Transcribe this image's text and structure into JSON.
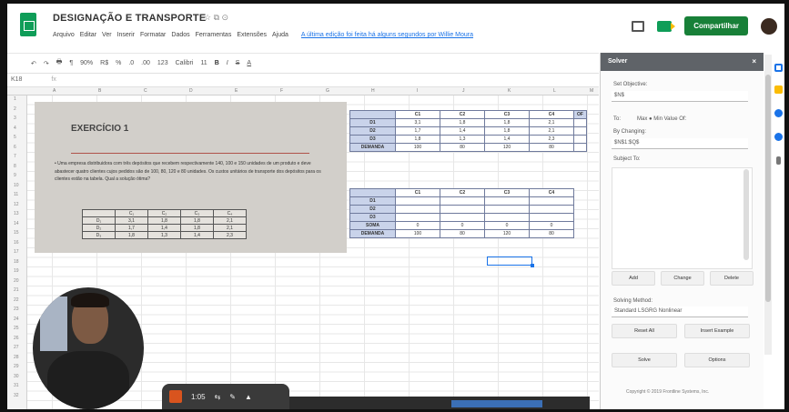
{
  "header": {
    "title": "DESIGNAÇÃO E TRANSPORTE",
    "title_icons": "☆ ⧉ ⊙",
    "menu": [
      "Arquivo",
      "Editar",
      "Ver",
      "Inserir",
      "Formatar",
      "Dados",
      "Ferramentas",
      "Extensões",
      "Ajuda"
    ],
    "last_edit": "A última edição foi feita há alguns segundos por Willie Moura",
    "share_label": "Compartilhar"
  },
  "toolbar": {
    "items": [
      "↶",
      "↷",
      "🖶",
      "¶",
      "90%",
      "R$",
      "%",
      ".0",
      ".00",
      "123",
      "Calibri",
      "11",
      "B",
      "I",
      "S",
      "A"
    ],
    "cell_ref": "K18",
    "fx": "fx"
  },
  "columns": [
    "A",
    "B",
    "C",
    "D",
    "E",
    "F",
    "G",
    "H",
    "I",
    "J",
    "K",
    "L",
    "M"
  ],
  "rows": [
    "1",
    "2",
    "3",
    "4",
    "5",
    "6",
    "7",
    "8",
    "9",
    "10",
    "11",
    "12",
    "13",
    "14",
    "15",
    "16",
    "17",
    "18",
    "19",
    "20",
    "21",
    "22",
    "23",
    "24",
    "25",
    "26",
    "27",
    "28",
    "29",
    "30",
    "31",
    "32"
  ],
  "exercise": {
    "title": "EXERCÍCIO 1",
    "text": "• Uma empresa distribuidora com três depósitos que recebem respectivamente 140, 100 e 150 unidades de um produto e deve abastecer quatro clientes cujos pedidos são de 100, 80, 120 e 80 unidades. Os custos unitários de transporte dos depósitos para os clientes estão na tabela. Qual a solução ótima?",
    "table": [
      [
        "",
        "C₁",
        "C₂",
        "C₃",
        "C₄"
      ],
      [
        "D₁",
        "3,1",
        "1,8",
        "1,8",
        "2,1"
      ],
      [
        "D₂",
        "1,7",
        "1,4",
        "1,8",
        "2,1"
      ],
      [
        "D₃",
        "1,8",
        "1,3",
        "1,4",
        "2,3"
      ]
    ]
  },
  "cost_table": {
    "header": [
      "",
      "C1",
      "C2",
      "C3",
      "C4",
      "OF"
    ],
    "rows": [
      [
        "D1",
        "3,1",
        "1,8",
        "1,8",
        "2,1",
        ""
      ],
      [
        "D2",
        "1,7",
        "1,4",
        "1,8",
        "2,1",
        ""
      ],
      [
        "D3",
        "1,8",
        "1,3",
        "1,4",
        "2,3",
        ""
      ],
      [
        "DEMANDA",
        "100",
        "80",
        "120",
        "80",
        ""
      ]
    ]
  },
  "alloc_table": {
    "header": [
      "",
      "C1",
      "C2",
      "C3",
      "C4"
    ],
    "rows": [
      [
        "D1",
        "",
        "",
        "",
        ""
      ],
      [
        "D2",
        "",
        "",
        "",
        ""
      ],
      [
        "D3",
        "",
        "",
        "",
        ""
      ],
      [
        "SOMA",
        "0",
        "0",
        "0",
        "0"
      ],
      [
        "DEMANDA",
        "100",
        "80",
        "120",
        "80"
      ]
    ]
  },
  "solver": {
    "title": "Solver",
    "close": "×",
    "set_objective_label": "Set Objective:",
    "set_objective_value": "$N$",
    "to_label": "To:",
    "to_options": "Max ● Min   Value Of:",
    "by_changing_label": "By Changing:",
    "by_changing_value": "$N$1:$Q$",
    "subject_to_label": "Subject To:",
    "buttons_row1": [
      "Add",
      "Change",
      "Delete"
    ],
    "solving_method_label": "Solving Method:",
    "solving_method_value": "Standard LSGRG Nonlinear",
    "buttons_row2": [
      "Reset All",
      "Insert Example"
    ],
    "buttons_row3": [
      "Solve",
      "Options"
    ],
    "footer": "Copyright © 2019 Frontline Systems, Inc."
  },
  "video_bar": {
    "time": "1:05",
    "icons": [
      "⇆",
      "✎",
      "▲"
    ]
  }
}
